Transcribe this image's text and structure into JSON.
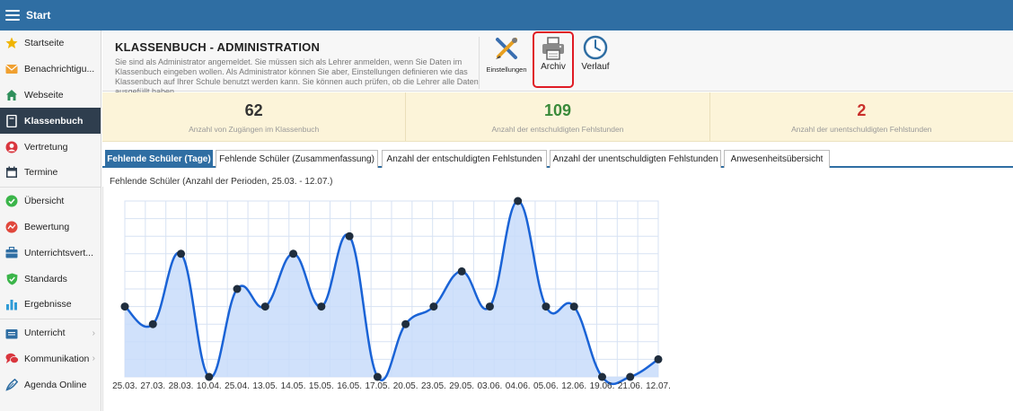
{
  "topbar": {
    "title": "Start"
  },
  "sidebar": {
    "items": [
      {
        "label": "Startseite",
        "icon": "star-icon",
        "color": "#f0b400"
      },
      {
        "label": "Benachrichtigu...",
        "icon": "envelope-icon",
        "color": "#f0a030"
      },
      {
        "label": "Webseite",
        "icon": "home-icon",
        "color": "#2f8f5b"
      },
      {
        "label": "Klassenbuch",
        "icon": "book-icon",
        "color": "#ffffff",
        "active": true
      },
      {
        "label": "Vertretung",
        "icon": "person-icon",
        "color": "#d9363e"
      },
      {
        "label": "Termine",
        "icon": "calendar-icon",
        "color": "#2f3e4e"
      },
      {
        "label": "Übersicht",
        "icon": "check-circle-icon",
        "color": "#3bb54a"
      },
      {
        "label": "Bewertung",
        "icon": "rating-icon",
        "color": "#e0473c"
      },
      {
        "label": "Unterrichtsvert...",
        "icon": "briefcase-icon",
        "color": "#2f6ea3"
      },
      {
        "label": "Standards",
        "icon": "shield-icon",
        "color": "#3bb54a"
      },
      {
        "label": "Ergebnisse",
        "icon": "bar-chart-icon",
        "color": "#2f9bd6"
      },
      {
        "label": "Unterricht",
        "icon": "folder-icon",
        "color": "#2f6ea3",
        "chevron": true
      },
      {
        "label": "Kommunikation",
        "icon": "chat-icon",
        "color": "#d9363e",
        "chevron": true
      },
      {
        "label": "Agenda Online",
        "icon": "pen-icon",
        "color": "#2f6ea3"
      }
    ]
  },
  "header": {
    "title": "KLASSENBUCH - ADMINISTRATION",
    "description": "Sie sind als Administrator angemeldet. Sie müssen sich als Lehrer anmelden, wenn Sie Daten im Klassenbuch eingeben wollen. Als Administrator können Sie aber, Einstellungen definieren wie das Klassenbuch auf Ihrer Schule benutzt werden kann. Sie können auch prüfen, ob die Lehrer alle Daten ausgefüllt haben.",
    "tools": [
      {
        "label": "Einstellungen",
        "icon": "settings-tools-icon"
      },
      {
        "label": "Archiv",
        "icon": "printer-icon"
      },
      {
        "label": "Verlauf",
        "icon": "clock-icon"
      }
    ]
  },
  "stats": [
    {
      "value": "62",
      "label": "Anzahl von Zugängen im Klassenbuch",
      "color": "#333333"
    },
    {
      "value": "109",
      "label": "Anzahl der entschuldigten Fehlstunden",
      "color": "#3a8a3a"
    },
    {
      "value": "2",
      "label": "Anzahl der unentschuldigten Fehlstunden",
      "color": "#c9302c"
    }
  ],
  "tabs": [
    {
      "label": "Fehlende Schüler (Tage)",
      "active": true
    },
    {
      "label": "Fehlende Schüler (Zusammenfassung)"
    },
    {
      "label": "Anzahl der entschuldigten Fehlstunden"
    },
    {
      "label": "Anzahl der unentschuldigten Fehlstunden"
    },
    {
      "label": "Anwesenheitsübersicht"
    }
  ],
  "chart_data": {
    "type": "area",
    "title": "Fehlende Schüler (Anzahl der Perioden, 25.03. - 12.07.)",
    "x": [
      "25.03.",
      "27.03.",
      "28.03.",
      "10.04.",
      "25.04.",
      "13.05.",
      "14.05.",
      "15.05.",
      "16.05.",
      "17.05.",
      "20.05.",
      "23.05.",
      "29.05.",
      "03.06.",
      "04.06.",
      "05.06.",
      "12.06.",
      "19.06.",
      "21.06.",
      "12.07."
    ],
    "values": [
      4,
      3,
      7,
      0,
      5,
      4,
      7,
      4,
      8,
      0,
      3,
      4,
      6,
      4,
      10,
      4,
      4,
      0,
      0,
      1
    ],
    "ylim": [
      0,
      10
    ],
    "grid": true,
    "line_color": "#1a63d6",
    "fill_color": "#c8dcfa",
    "marker_color": "#1f2d3d"
  }
}
